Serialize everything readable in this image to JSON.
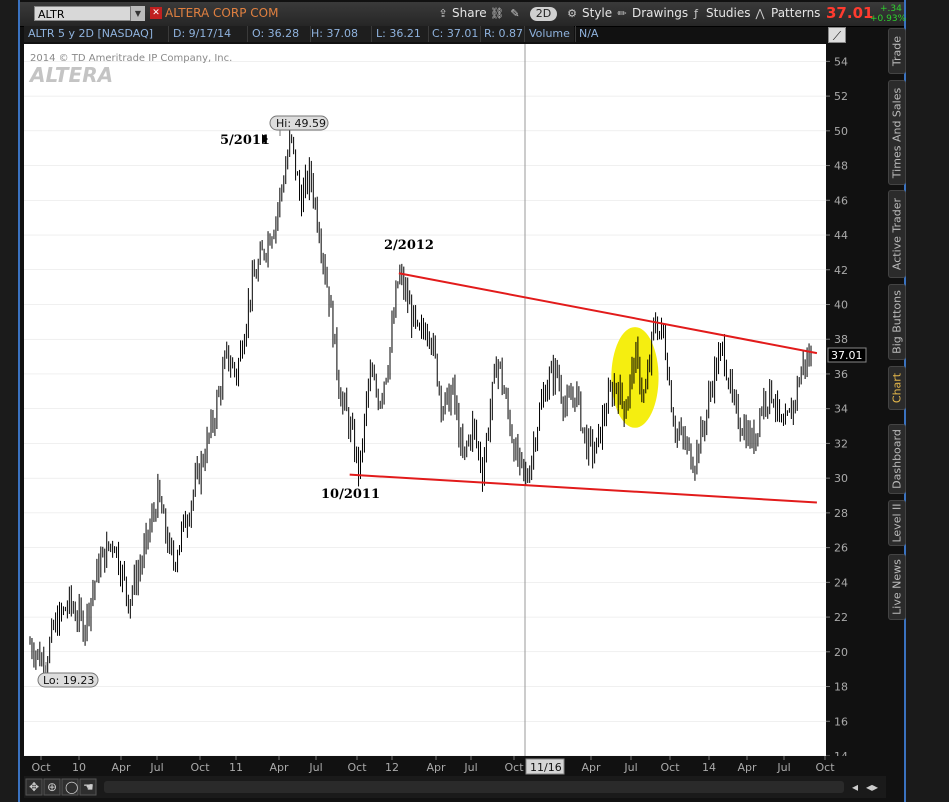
{
  "toolbar": {
    "symbol": "ALTR",
    "company": "ALTERA CORP COM",
    "share_label": "Share",
    "aggregation_label": "2D",
    "style_label": "Style",
    "drawings_label": "Drawings",
    "studies_label": "Studies",
    "patterns_label": "Patterns",
    "last_price": "37.01",
    "change": "+.34",
    "change_pct": "+0.93%"
  },
  "info_bar": {
    "title": "ALTR 5 y 2D [NASDAQ]",
    "date": "D: 9/17/14",
    "open": "O: 36.28",
    "high": "H: 37.08",
    "low": "L: 36.21",
    "close": "C: 37.01",
    "range": "R: 0.87",
    "volume_label": "Volume",
    "volume_value": "N/A"
  },
  "watermark": {
    "copyright": "2014 © TD Ameritrade IP Company, Inc.",
    "logo": "ALTERA"
  },
  "side_tabs": [
    "Trade",
    "Times And Sales",
    "Active Trader",
    "Big Buttons",
    "Chart",
    "Dashboard",
    "Level II",
    "Live News"
  ],
  "active_tab": "Chart",
  "chart_data": {
    "type": "candlestick",
    "ylim": [
      14,
      55
    ],
    "yticks": [
      14,
      16,
      18,
      20,
      22,
      24,
      26,
      28,
      30,
      32,
      34,
      36,
      38,
      40,
      42,
      44,
      46,
      48,
      50,
      52,
      54
    ],
    "xtick_labels": [
      "Oct",
      "10",
      "Apr",
      "Jul",
      "Oct",
      "11",
      "Apr",
      "Jul",
      "Oct",
      "12",
      "Apr",
      "Jul",
      "Oct",
      "Apr",
      "Jul",
      "Oct",
      "14",
      "Apr",
      "Jul",
      "Oct"
    ],
    "cursor_label": "11/16",
    "last_value_label": "37.01",
    "hi_label": "Hi: 49.59",
    "lo_label": "Lo: 19.23",
    "annotations": [
      "5/2011",
      "2/2012",
      "10/2011"
    ],
    "price_path": [
      [
        0,
        20.5
      ],
      [
        3,
        19.3
      ],
      [
        5,
        21.5
      ],
      [
        8,
        22.8
      ],
      [
        11,
        21.5
      ],
      [
        14,
        25
      ],
      [
        17,
        26.5
      ],
      [
        20,
        23
      ],
      [
        23,
        25.5
      ],
      [
        26,
        29
      ],
      [
        29,
        25
      ],
      [
        31,
        27
      ],
      [
        34,
        30
      ],
      [
        37,
        33
      ],
      [
        40,
        37
      ],
      [
        42,
        36
      ],
      [
        45,
        41
      ],
      [
        48,
        43.5
      ],
      [
        50,
        45
      ],
      [
        52,
        48
      ],
      [
        53,
        49.6
      ],
      [
        55,
        46
      ],
      [
        57,
        47.5
      ],
      [
        59,
        44
      ],
      [
        61,
        40
      ],
      [
        63,
        35
      ],
      [
        65,
        33
      ],
      [
        67,
        30.3
      ],
      [
        69,
        36
      ],
      [
        71,
        34.5
      ],
      [
        73,
        37
      ],
      [
        75,
        41.8
      ],
      [
        77,
        40
      ],
      [
        79,
        38
      ],
      [
        81,
        39
      ],
      [
        84,
        34
      ],
      [
        86,
        35
      ],
      [
        88,
        31
      ],
      [
        90,
        33
      ],
      [
        92,
        30.5
      ],
      [
        95,
        37
      ],
      [
        97,
        34
      ],
      [
        99,
        31
      ],
      [
        101,
        29.8
      ],
      [
        103,
        33
      ],
      [
        105,
        35.5
      ],
      [
        107,
        36.2
      ],
      [
        109,
        34
      ],
      [
        111,
        35
      ],
      [
        113,
        32
      ],
      [
        115,
        31.5
      ],
      [
        117,
        34
      ],
      [
        119,
        35.5
      ],
      [
        121,
        34
      ],
      [
        123,
        37
      ],
      [
        125,
        34.5
      ],
      [
        127,
        39
      ],
      [
        129,
        38
      ],
      [
        131,
        33
      ],
      [
        133,
        32
      ],
      [
        135,
        31
      ],
      [
        137,
        33
      ],
      [
        139,
        36
      ],
      [
        141,
        37.5
      ],
      [
        143,
        34
      ],
      [
        145,
        33
      ],
      [
        147,
        32
      ],
      [
        149,
        34.5
      ],
      [
        151,
        35
      ],
      [
        153,
        32.5
      ],
      [
        155,
        34
      ],
      [
        157,
        36.5
      ],
      [
        159,
        37.08
      ]
    ],
    "price_path_x_max": 159,
    "resistance_line": {
      "from": [
        75,
        41.8
      ],
      "to": [
        160,
        37.2
      ]
    },
    "support_line": {
      "from": [
        65,
        30.2
      ],
      "to": [
        160,
        28.6
      ]
    },
    "highlight": {
      "center": [
        123,
        35.8
      ],
      "rx": 4.8,
      "ry": 2.9
    },
    "colors": {
      "background": "#ffffff",
      "price": "#000000",
      "trendline": "#e21b1b",
      "highlight": "#f5ee10",
      "grid": "#e0e0e0"
    }
  },
  "icons": [
    "share-icon",
    "link-icon",
    "style-icon",
    "drawings-icon",
    "studies-icon",
    "patterns-icon",
    "zoom-in-icon",
    "zoom-out-icon",
    "scroll-left-icon",
    "scroll-right-icon"
  ]
}
